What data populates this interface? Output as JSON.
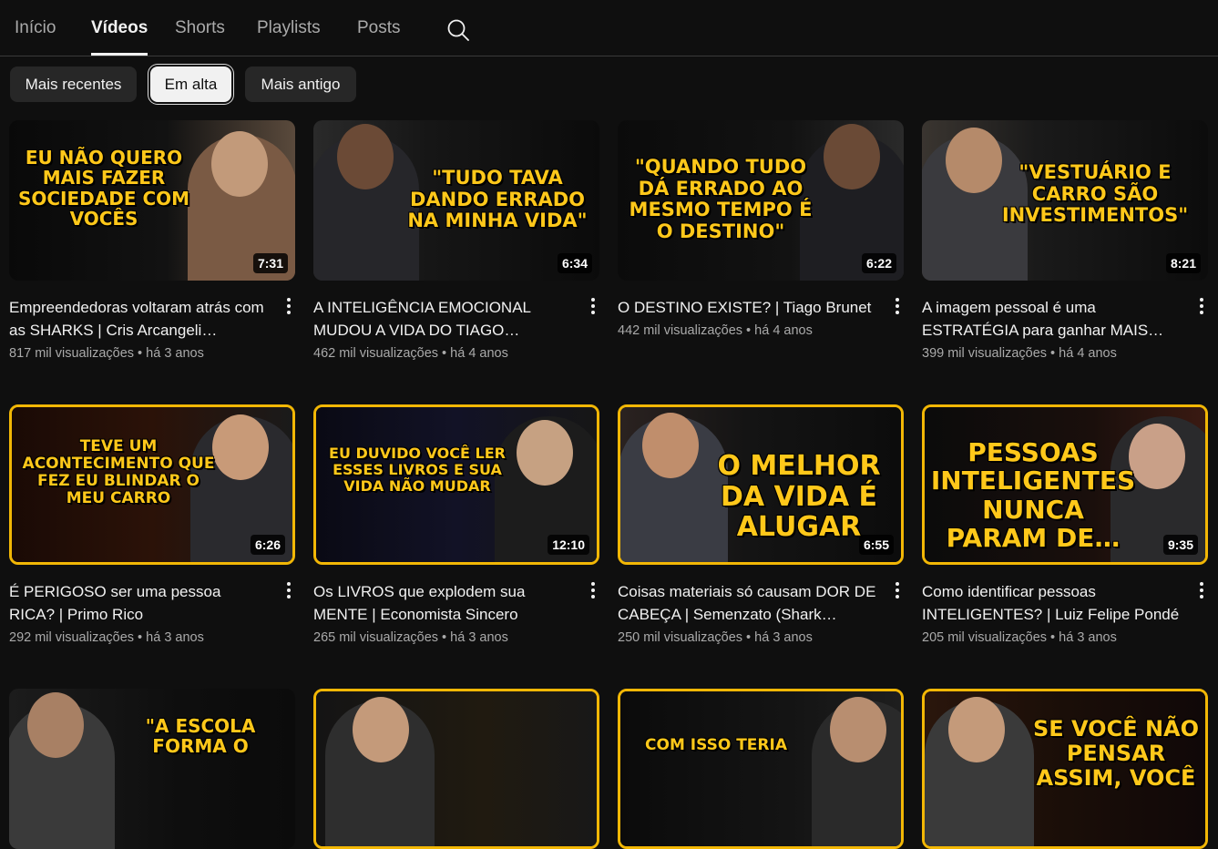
{
  "tabs": [
    {
      "label": "Início"
    },
    {
      "label": "Vídeos"
    },
    {
      "label": "Shorts"
    },
    {
      "label": "Playlists"
    },
    {
      "label": "Posts"
    }
  ],
  "active_tab": "Vídeos",
  "icons": {
    "search": "search-icon",
    "menu": "more-vert-icon"
  },
  "colors": {
    "background": "#0f0f0f",
    "accent_yellow": "#ffc81a",
    "secondary_text": "#aaaaaa"
  },
  "filters": [
    {
      "label": "Mais recentes"
    },
    {
      "label": "Em alta"
    },
    {
      "label": "Mais antigo"
    }
  ],
  "active_filter": "Em alta",
  "videos": [
    {
      "caption": "EU NÃO QUERO MAIS FAZER SOCIEDADE COM VOCÊS",
      "duration": "7:31",
      "title": "Empreendedoras voltaram atrás com as SHARKS | Cris Arcangeli…",
      "views": "817 mil visualizações",
      "age": "há 3 anos"
    },
    {
      "caption": "\"TUDO TAVA DANDO ERRADO NA MINHA VIDA\"",
      "duration": "6:34",
      "title": "A INTELIGÊNCIA EMOCIONAL MUDOU A VIDA DO TIAGO BRUNE…",
      "views": "462 mil visualizações",
      "age": "há 4 anos"
    },
    {
      "caption": "\"QUANDO TUDO DÁ ERRADO AO MESMO TEMPO É O DESTINO\"",
      "duration": "6:22",
      "title": "O DESTINO EXISTE? | Tiago Brunet",
      "views": "442 mil visualizações",
      "age": "há 4 anos"
    },
    {
      "caption": "\"VESTUÁRIO E CARRO SÃO INVESTIMENTOS\"",
      "duration": "8:21",
      "title": "A imagem pessoal é uma ESTRATÉGIA para ganhar MAIS…",
      "views": "399 mil visualizações",
      "age": "há 4 anos"
    },
    {
      "caption": "TEVE UM ACONTECIMENTO QUE FEZ EU BLINDAR O MEU CARRO",
      "duration": "6:26",
      "title": "É PERIGOSO ser uma pessoa RICA? | Primo Rico",
      "views": "292 mil visualizações",
      "age": "há 3 anos"
    },
    {
      "caption": "EU DUVIDO VOCÊ LER ESSES LIVROS E SUA VIDA NÃO MUDAR",
      "duration": "12:10",
      "title": "Os LIVROS que explodem sua MENTE | Economista Sincero",
      "views": "265 mil visualizações",
      "age": "há 3 anos"
    },
    {
      "caption": "O MELHOR DA VIDA É ALUGAR",
      "duration": "6:55",
      "title": "Coisas materiais só causam DOR DE CABEÇA | Semenzato (Shark…",
      "views": "250 mil visualizações",
      "age": "há 3 anos"
    },
    {
      "caption": "PESSOAS INTELIGENTES NUNCA PARAM DE…",
      "duration": "9:35",
      "title": "Como identificar pessoas INTELIGENTES? | Luiz Felipe Pondé",
      "views": "205 mil visualizações",
      "age": "há 3 anos"
    },
    {
      "caption": "\"A ESCOLA FORMA O",
      "duration": "",
      "title": "",
      "views": "",
      "age": ""
    },
    {
      "caption": "",
      "duration": "",
      "title": "",
      "views": "",
      "age": ""
    },
    {
      "caption": "COM ISSO TERIA",
      "duration": "",
      "title": "",
      "views": "",
      "age": ""
    },
    {
      "caption": "SE VOCÊ NÃO PENSAR ASSIM, VOCÊ",
      "duration": "",
      "title": "",
      "views": "",
      "age": ""
    }
  ]
}
